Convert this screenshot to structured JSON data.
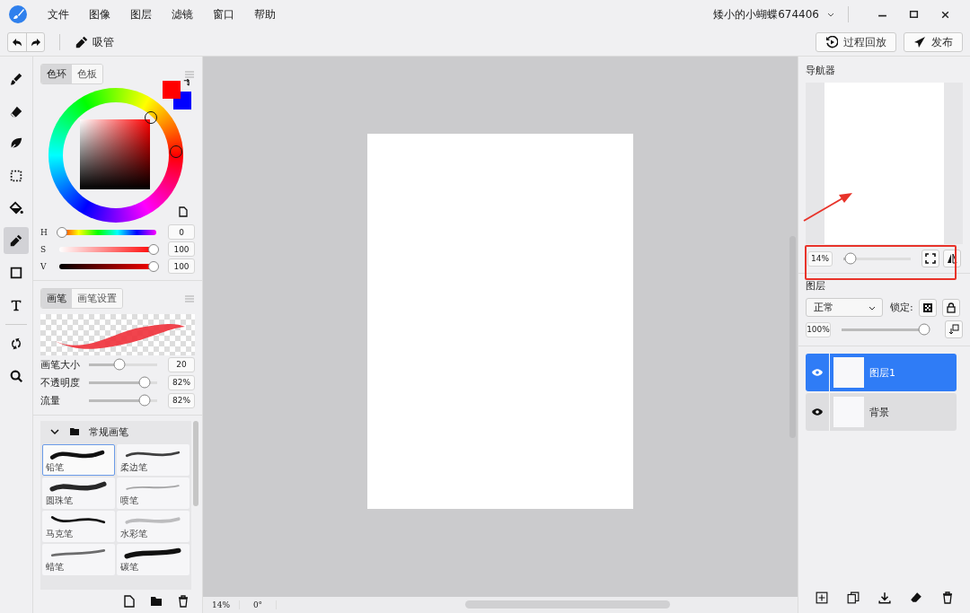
{
  "menu": [
    "文件",
    "图像",
    "图层",
    "滤镜",
    "窗口",
    "帮助"
  ],
  "user": {
    "name": "矮小的小蝴蝶674406"
  },
  "toolbar": {
    "tool_label": "吸管",
    "buttons": [
      {
        "kind": "replay",
        "label": "过程回放"
      },
      {
        "kind": "publish",
        "label": "发布"
      }
    ]
  },
  "tools": [
    {
      "kind": "brush",
      "selected": false
    },
    {
      "kind": "eraser",
      "selected": false
    },
    {
      "kind": "leaf",
      "selected": false
    },
    {
      "kind": "select",
      "selected": false
    },
    {
      "kind": "bucket",
      "selected": false
    },
    {
      "kind": "eyedropper",
      "selected": true
    },
    {
      "kind": "rect",
      "selected": false
    },
    {
      "kind": "text",
      "selected": false
    },
    {
      "kind": "rotate",
      "selected": false
    },
    {
      "kind": "zoom",
      "selected": false
    }
  ],
  "color_panel": {
    "tabs": [
      {
        "label": "色环",
        "selected": true
      },
      {
        "label": "色板",
        "selected": false
      }
    ],
    "swatches": [
      {
        "kind": "secondary",
        "color": "#0000ff"
      },
      {
        "kind": "primary",
        "color": "#ff0000"
      }
    ],
    "sliders": [
      {
        "label": "H",
        "level": 0,
        "value": "0"
      },
      {
        "label": "S",
        "level": 1,
        "value": "100"
      },
      {
        "label": "V",
        "level": 1,
        "value": "100"
      }
    ]
  },
  "brush_panel": {
    "tabs": [
      {
        "label": "画笔",
        "selected": true
      },
      {
        "label": "画笔设置",
        "selected": false
      }
    ],
    "sliders": [
      {
        "label": "画笔大小",
        "level": 0.45,
        "value": "20"
      },
      {
        "label": "不透明度",
        "level": 0.82,
        "value": "82%"
      },
      {
        "label": "流量",
        "level": 0.82,
        "value": "82%"
      }
    ],
    "group": {
      "name": "常规画笔",
      "expanded": true
    },
    "brushes": [
      {
        "name": "铅笔",
        "selected": true
      },
      {
        "name": "柔边笔",
        "selected": false
      },
      {
        "name": "圆珠笔",
        "selected": false
      },
      {
        "name": "喷笔",
        "selected": false
      },
      {
        "name": "马克笔",
        "selected": false
      },
      {
        "name": "水彩笔",
        "selected": false
      },
      {
        "name": "蜡笔",
        "selected": false
      },
      {
        "name": "碳笔",
        "selected": false
      }
    ]
  },
  "status_bar": {
    "zoom": "14%",
    "rotation": "0°"
  },
  "navigator": {
    "title": "导航器",
    "zoom": "14%",
    "level": 0.1
  },
  "layers_panel": {
    "title": "图层",
    "blend_mode": "正常",
    "lock_label": "锁定:",
    "opacity": "100%",
    "level": 0.97,
    "layers": [
      {
        "name": "图层1",
        "selected": true,
        "visible": true
      },
      {
        "name": "背景",
        "selected": false,
        "visible": true
      }
    ]
  },
  "callouts": [
    {
      "kind": "frame"
    },
    {
      "kind": "arrow"
    }
  ]
}
